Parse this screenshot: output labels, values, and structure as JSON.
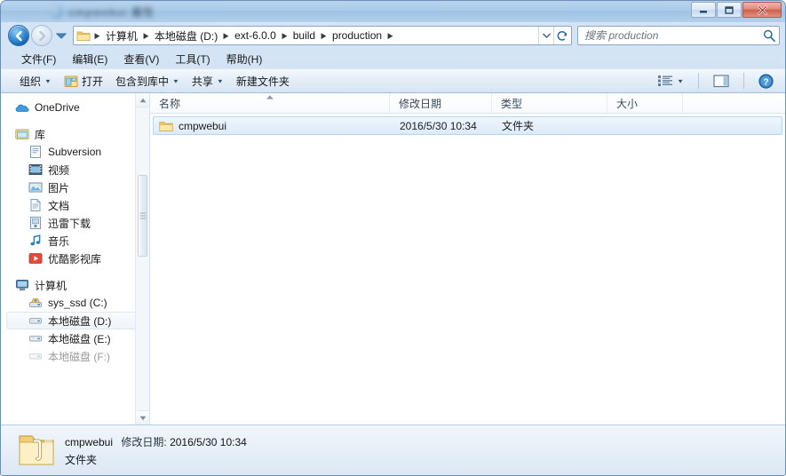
{
  "window": {
    "title": "cmpwebui 属性",
    "controls": {
      "minimize": "最小化",
      "maximize": "最大化",
      "close": "关闭"
    }
  },
  "nav": {
    "back_label": "后退",
    "forward_label": "前进",
    "recent_label": "最近浏览的页面",
    "refresh_label": "刷新",
    "dropdown_label": "以前的位置"
  },
  "breadcrumb": {
    "items": [
      {
        "label": "计算机"
      },
      {
        "label": "本地磁盘 (D:)"
      },
      {
        "label": "ext-6.0.0"
      },
      {
        "label": "build"
      },
      {
        "label": "production"
      }
    ]
  },
  "search": {
    "placeholder": "搜索 production",
    "value": "",
    "icon": "search-icon"
  },
  "menubar": {
    "items": [
      {
        "label": "文件(F)"
      },
      {
        "label": "编辑(E)"
      },
      {
        "label": "查看(V)"
      },
      {
        "label": "工具(T)"
      },
      {
        "label": "帮助(H)"
      }
    ]
  },
  "toolbar": {
    "organize": "组织",
    "open": "打开",
    "include_in_library": "包含到库中",
    "share": "共享",
    "new_folder": "新建文件夹",
    "view_label": "更改您的视图",
    "preview_label": "显示预览窗格",
    "help_label": "获取帮助"
  },
  "sidebar": {
    "onedrive": {
      "label": "OneDrive",
      "icon": "cloud-icon"
    },
    "libraries": {
      "label": "库",
      "icon": "library-icon",
      "items": [
        {
          "label": "Subversion",
          "icon": "subversion-icon"
        },
        {
          "label": "视频",
          "icon": "video-icon"
        },
        {
          "label": "图片",
          "icon": "pictures-icon"
        },
        {
          "label": "文档",
          "icon": "documents-icon"
        },
        {
          "label": "迅雷下载",
          "icon": "thunder-download-icon"
        },
        {
          "label": "音乐",
          "icon": "music-icon"
        },
        {
          "label": "优酷影视库",
          "icon": "youku-icon"
        }
      ]
    },
    "computer": {
      "label": "计算机",
      "icon": "computer-icon",
      "items": [
        {
          "label": "sys_ssd (C:)",
          "icon": "system-drive-icon",
          "selected": false
        },
        {
          "label": "本地磁盘 (D:)",
          "icon": "drive-icon",
          "selected": true
        },
        {
          "label": "本地磁盘 (E:)",
          "icon": "drive-icon",
          "selected": false
        },
        {
          "label": "本地磁盘 (F:)",
          "icon": "drive-icon",
          "selected": false
        }
      ]
    }
  },
  "filelist": {
    "columns": [
      {
        "label": "名称",
        "sorted": "asc"
      },
      {
        "label": "修改日期",
        "sorted": ""
      },
      {
        "label": "类型",
        "sorted": ""
      },
      {
        "label": "大小",
        "sorted": ""
      }
    ],
    "rows": [
      {
        "name": "cmpwebui",
        "modified": "2016/5/30 10:34",
        "type": "文件夹",
        "size": "",
        "icon": "folder-icon",
        "selected": true
      }
    ]
  },
  "statusbar": {
    "name": "cmpwebui",
    "modified_label": "修改日期:",
    "modified_value": "2016/5/30 10:34",
    "type": "文件夹",
    "icon": "folder-large-icon"
  },
  "colors": {
    "accent": "#2a6ba5",
    "frame": "#c9dcf0",
    "selection": "#dceafa",
    "folder": "#f5d076"
  }
}
